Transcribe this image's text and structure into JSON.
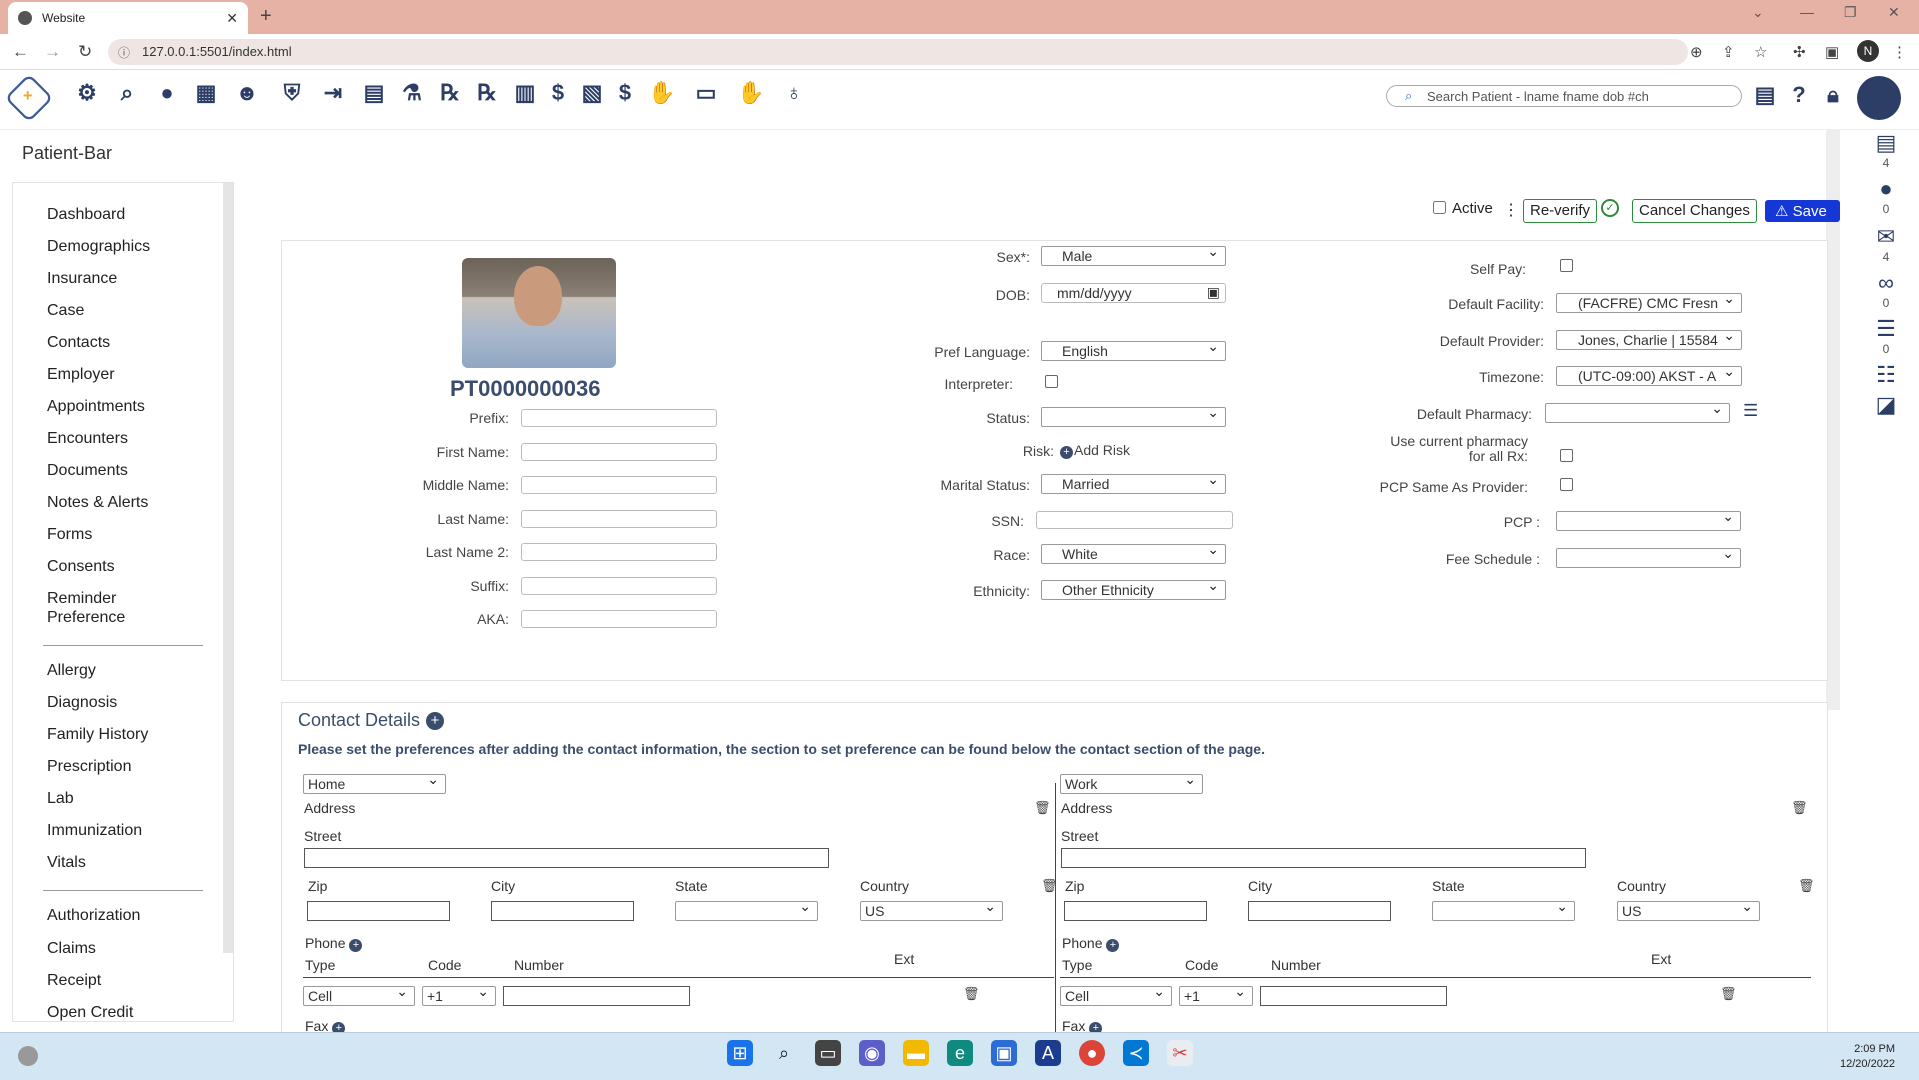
{
  "browser": {
    "tab_title": "Website",
    "url": "127.0.0.1:5501/index.html",
    "profile_initial": "N"
  },
  "toolbar": {
    "search_placeholder": "Search Patient - lname fname dob #ch",
    "icons": [
      "settings-icon",
      "search-icon",
      "user-icon",
      "calendar-icon",
      "user-lock-icon",
      "shield-icon",
      "sign-out-icon",
      "calendar-plus-icon",
      "flask-icon",
      "rx-icon",
      "rx-icon",
      "document-icon",
      "dollar-icon",
      "invoice-dollar-icon",
      "dollar-icon",
      "hand-holding-icon",
      "card-icon",
      "hand-holding-icon",
      "money-bag-icon"
    ]
  },
  "rail": [
    {
      "icon": "fax-icon",
      "count": "4"
    },
    {
      "icon": "chat-icon",
      "count": "0"
    },
    {
      "icon": "mail-icon",
      "count": "4"
    },
    {
      "icon": "voicemail-icon",
      "count": "0"
    },
    {
      "icon": "list-icon",
      "count": "0"
    },
    {
      "icon": "tasks-icon",
      "count": ""
    },
    {
      "icon": "note-icon",
      "count": ""
    }
  ],
  "page_title": "Patient-Bar",
  "sidebar": {
    "group1": [
      "Dashboard",
      "Demographics",
      "Insurance",
      "Case",
      "Contacts",
      "Employer",
      "Appointments",
      "Encounters",
      "Documents",
      "Notes & Alerts",
      "Forms",
      "Consents",
      "Reminder",
      "Preference"
    ],
    "group2": [
      "Allergy",
      "Diagnosis",
      "Family History",
      "Prescription",
      "Lab",
      "Immunization",
      "Vitals"
    ],
    "group3": [
      "Authorization",
      "Claims",
      "Receipt",
      "Open Credit"
    ]
  },
  "header": {
    "active_label": "Active",
    "reverify_label": "Re-verify",
    "cancel_label": "Cancel Changes",
    "save_label": "Save"
  },
  "patient": {
    "id": "PT0000000036",
    "name_labels": [
      "Prefix:",
      "First Name:",
      "Middle Name:",
      "Last Name:",
      "Last Name 2:",
      "Suffix:",
      "AKA:"
    ],
    "sex_label": "Sex*:",
    "sex": "Male",
    "dob_label": "DOB:",
    "dob_placeholder": "mm/dd/yyyy",
    "lang_label": "Pref Language:",
    "lang": "English",
    "interp_label": "Interpreter:",
    "status_label": "Status:",
    "risk_label": "Risk:",
    "add_risk": "Add Risk",
    "marital_label": "Marital Status:",
    "marital": "Married",
    "ssn_label": "SSN:",
    "race_label": "Race:",
    "race": "White",
    "eth_label": "Ethnicity:",
    "eth": "Other Ethnicity",
    "selfpay_label": "Self Pay:",
    "facility_label": "Default Facility:",
    "facility": "(FACFRE) CMC Fresn",
    "provider_label": "Default Provider:",
    "provider": "Jones, Charlie | 15584",
    "tz_label": "Timezone:",
    "tz": "(UTC-09:00) AKST - A",
    "pharm_label": "Default Pharmacy:",
    "usepharm_label1": "Use current pharmacy",
    "usepharm_label2": "for all Rx:",
    "pcpsame_label": "PCP Same As Provider:",
    "pcp_label": "PCP :",
    "fee_label": "Fee Schedule :"
  },
  "contact": {
    "title": "Contact Details",
    "note": "Please set the preferences after adding the contact information, the section to set preference can be found below the contact section of the page.",
    "blocks": [
      {
        "type": "Home",
        "country": "US",
        "phone_type": "Cell",
        "code": "+1"
      },
      {
        "type": "Work",
        "country": "US",
        "phone_type": "Cell",
        "code": "+1"
      }
    ],
    "labels": {
      "address": "Address",
      "street": "Street",
      "zip": "Zip",
      "city": "City",
      "state": "State",
      "country": "Country",
      "phone": "Phone",
      "type": "Type",
      "code": "Code",
      "number": "Number",
      "ext": "Ext",
      "fax": "Fax"
    }
  },
  "taskbar": {
    "time": "2:09 PM",
    "date": "12/20/2022"
  }
}
